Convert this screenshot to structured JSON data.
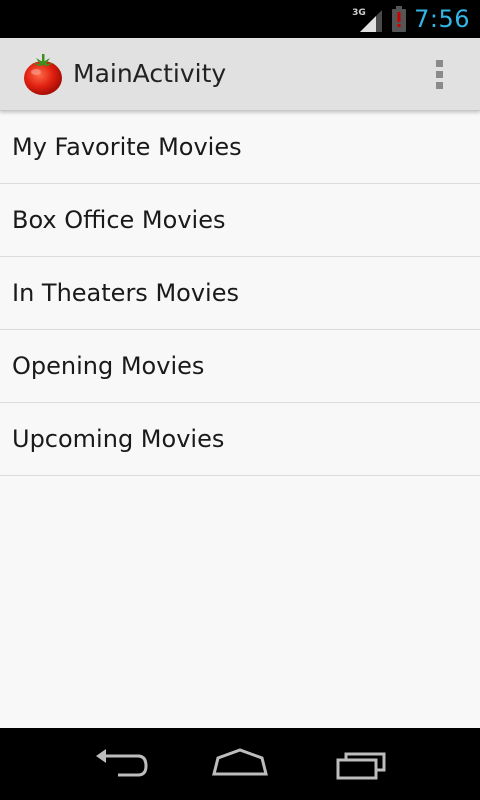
{
  "status_bar": {
    "network_type": "3G",
    "time": "7:56",
    "icons": [
      "signal-icon",
      "battery-alert-icon"
    ]
  },
  "action_bar": {
    "app_icon": "tomato-icon",
    "title": "MainActivity",
    "overflow_icon": "overflow-menu-icon"
  },
  "menu": {
    "items": [
      {
        "label": "My Favorite Movies"
      },
      {
        "label": "Box Office Movies"
      },
      {
        "label": "In Theaters Movies"
      },
      {
        "label": "Opening Movies"
      },
      {
        "label": "Upcoming Movies"
      }
    ]
  },
  "nav_bar": {
    "buttons": [
      "back-icon",
      "home-icon",
      "recent-apps-icon"
    ]
  },
  "colors": {
    "status_bar_bg": "#000000",
    "clock": "#33b5e5",
    "action_bar_bg": "#e1e1e1",
    "list_bg": "#f8f8f8",
    "battery_alert": "#cc0000"
  }
}
